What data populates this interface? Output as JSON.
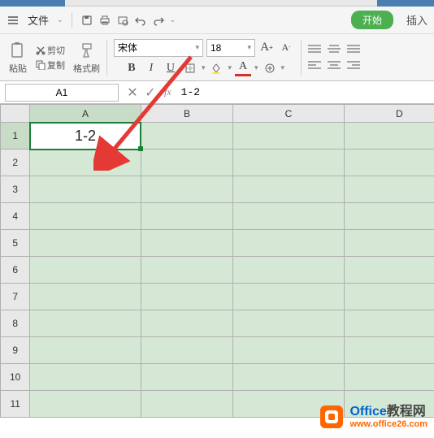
{
  "menubar": {
    "file": "文件",
    "file_dd": "⌄"
  },
  "tabs": {
    "start": "开始",
    "insert": "插入"
  },
  "ribbon": {
    "paste": "粘贴",
    "cut": "剪切",
    "copy": "复制",
    "format_painter": "格式刷",
    "font_name": "宋体",
    "font_size": "18",
    "bold": "B",
    "italic": "I",
    "underline": "U",
    "font_color": "A",
    "fill_color": "A"
  },
  "formula_bar": {
    "name_box": "A1",
    "fx": "fx",
    "content": "1-2"
  },
  "grid": {
    "columns": [
      "A",
      "B",
      "C",
      "D"
    ],
    "rows": [
      "1",
      "2",
      "3",
      "4",
      "5",
      "6",
      "7",
      "8",
      "9",
      "10",
      "11"
    ],
    "active_cell_value": "1-2"
  },
  "watermark": {
    "brand_en": "Office",
    "brand_cn": "教程网",
    "url": "www.office26.com"
  }
}
